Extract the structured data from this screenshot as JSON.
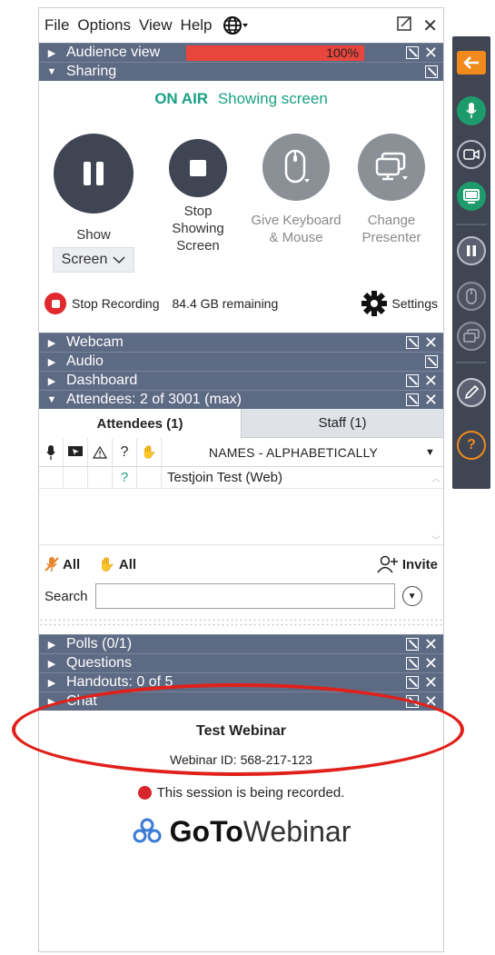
{
  "menu": {
    "file": "File",
    "options": "Options",
    "view": "View",
    "help": "Help"
  },
  "audience_view": {
    "label": "Audience view",
    "level_text": "100%",
    "level": 1.0
  },
  "sharing": {
    "label": "Sharing",
    "on_air": "ON AIR",
    "status": "Showing screen",
    "buttons": {
      "show_label": "Show",
      "screen_dropdown": "Screen",
      "stop_showing": "Stop Showing Screen",
      "give_keyboard": "Give Keyboard & Mouse",
      "change_presenter": "Change Presenter"
    },
    "stop_recording": "Stop Recording",
    "storage": "84.4 GB remaining",
    "settings": "Settings"
  },
  "sections": {
    "webcam": "Webcam",
    "audio": "Audio",
    "dashboard": "Dashboard",
    "attendees": "Attendees:  2 of 3001 (max)",
    "polls": "Polls (0/1)",
    "questions": "Questions",
    "handouts": "Handouts: 0 of 5",
    "chat": "Chat"
  },
  "attendees_panel": {
    "tabs": [
      "Attendees (1)",
      "Staff (1)"
    ],
    "column_name": "NAMES - ALPHABETICALLY",
    "rows": [
      {
        "q": "?",
        "name": "Testjoin Test (Web)"
      }
    ],
    "mute_all": "All",
    "hands_all": "All",
    "invite": "Invite",
    "search_label": "Search",
    "search_value": ""
  },
  "footer": {
    "webinar_title": "Test Webinar",
    "webinar_id": "Webinar ID: 568-217-123",
    "recording_notice": "This session is being recorded.",
    "logo_go": "GoTo",
    "logo_webinar": "Webinar"
  },
  "colors": {
    "section_bar": "#5d6a83",
    "on_air": "#1aa085",
    "meter": "#e8453c",
    "record": "#e0282e",
    "toolbar": "#3f4552",
    "toolbar_orange": "#f08a1c",
    "toolbar_green": "#1e9b6c",
    "annotation": "#e0201b"
  },
  "toolbar_icons": [
    "collapse-arrow-icon",
    "microphone-icon",
    "webcam-icon",
    "screen-share-icon",
    "pause-icon",
    "mouse-icon",
    "presenter-icon",
    "pen-icon",
    "question-icon"
  ]
}
